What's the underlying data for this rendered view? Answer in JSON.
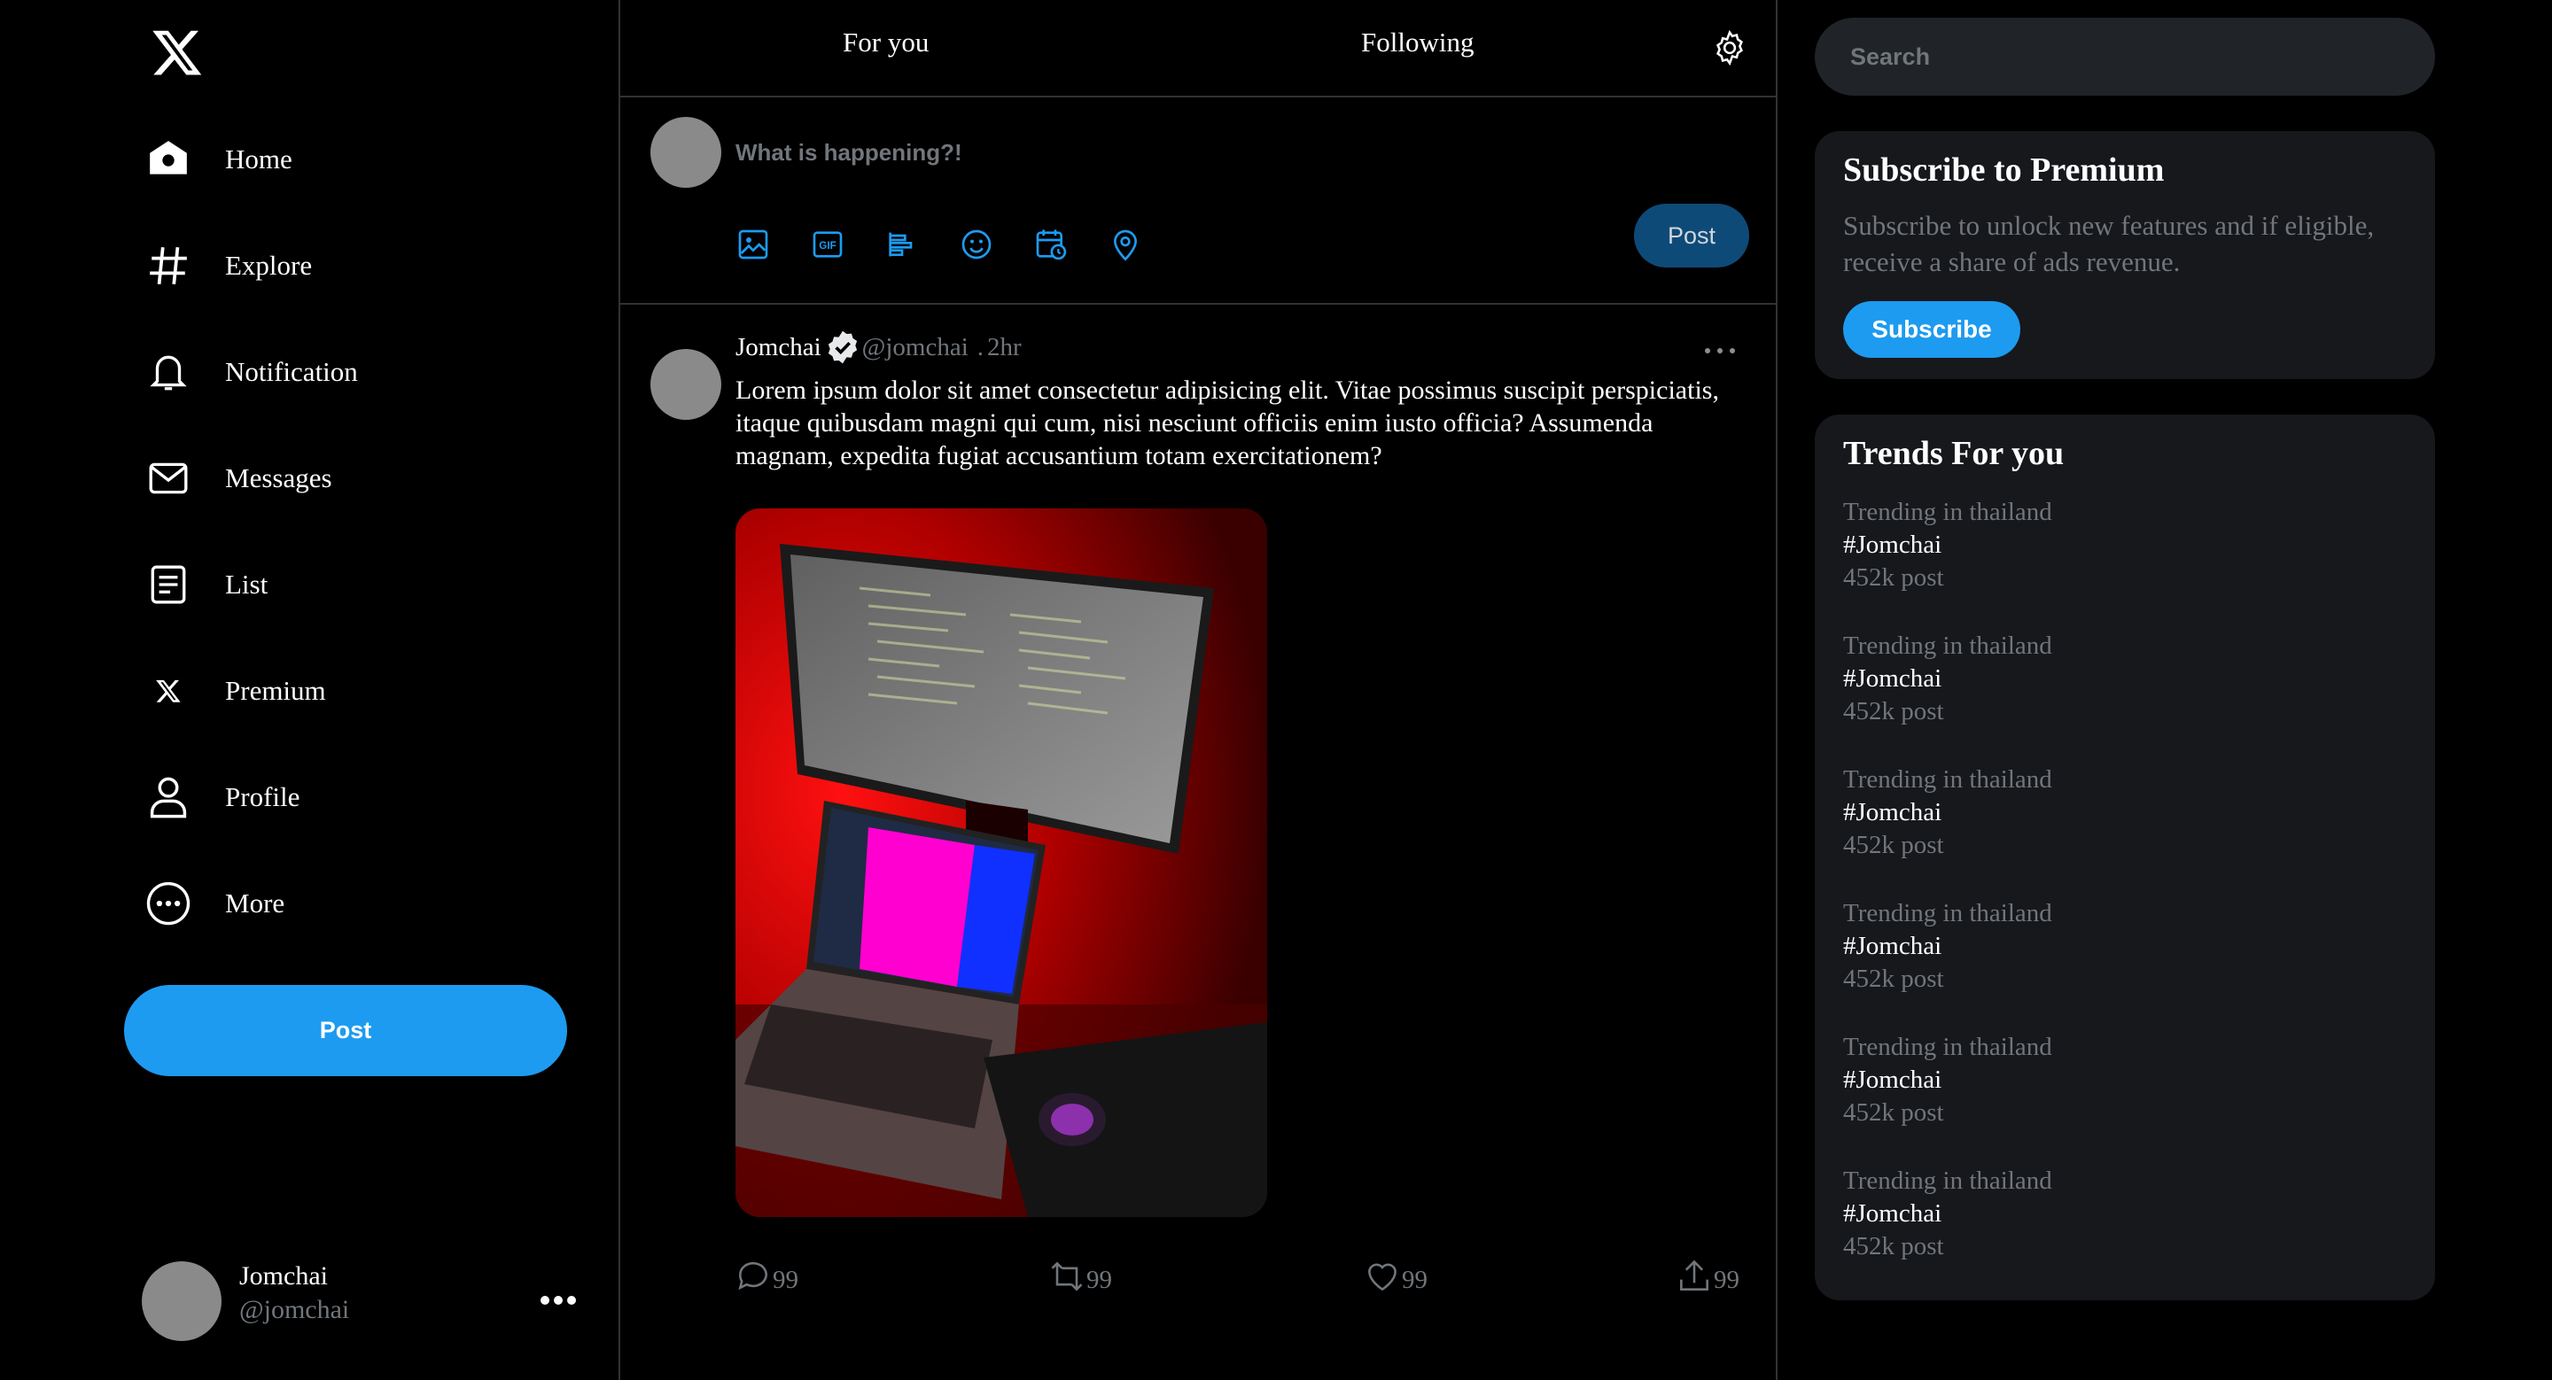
{
  "sidebar": {
    "items": [
      {
        "label": "Home",
        "icon": "home-icon"
      },
      {
        "label": "Explore",
        "icon": "hashtag-icon"
      },
      {
        "label": "Notification",
        "icon": "bell-icon"
      },
      {
        "label": "Messages",
        "icon": "envelope-icon"
      },
      {
        "label": "List",
        "icon": "list-icon"
      },
      {
        "label": "Premium",
        "icon": "x-logo-icon"
      },
      {
        "label": "Profile",
        "icon": "person-icon"
      },
      {
        "label": "More",
        "icon": "more-circle-icon"
      }
    ],
    "post_label": "Post",
    "account": {
      "name": "Jomchai",
      "handle": "@jomchai"
    }
  },
  "tabs": {
    "for_you": "For you",
    "following": "Following"
  },
  "composer": {
    "placeholder": "What is happening?!",
    "post_label": "Post",
    "tools": [
      "image-icon",
      "gif-icon",
      "poll-icon",
      "emoji-icon",
      "schedule-icon",
      "location-icon"
    ]
  },
  "tweet": {
    "name": "Jomchai",
    "handle": "@jomchai",
    "dot": ".",
    "time": "2hr",
    "text": "Lorem ipsum dolor sit amet consectetur adipisicing elit. Vitae possimus suscipit perspiciatis, itaque quibusdam magni qui cum, nisi nesciunt officiis enim iusto officia? Assumenda magnam, expedita fugiat accusantium totam exercitationem?",
    "replies": "99",
    "reposts": "99",
    "likes": "99",
    "shares": "99"
  },
  "right": {
    "search_placeholder": "Search",
    "premium": {
      "title": "Subscribe to Premium",
      "description": "Subscribe to unlock new features and if eligible, receive a share of ads revenue.",
      "button": "Subscribe"
    },
    "trends_title": "Trends For you",
    "trends": [
      {
        "meta": "Trending in thailand",
        "tag": "#Jomchai",
        "count": "452k post"
      },
      {
        "meta": "Trending in thailand",
        "tag": "#Jomchai",
        "count": "452k post"
      },
      {
        "meta": "Trending in thailand",
        "tag": "#Jomchai",
        "count": "452k post"
      },
      {
        "meta": "Trending in thailand",
        "tag": "#Jomchai",
        "count": "452k post"
      },
      {
        "meta": "Trending in thailand",
        "tag": "#Jomchai",
        "count": "452k post"
      },
      {
        "meta": "Trending in thailand",
        "tag": "#Jomchai",
        "count": "452k post"
      }
    ]
  },
  "colors": {
    "accent": "#1d9bf0",
    "background": "#000000",
    "card": "#16181c",
    "muted": "#71767b"
  }
}
